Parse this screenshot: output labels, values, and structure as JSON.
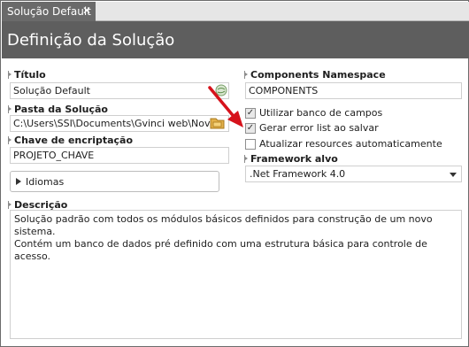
{
  "tab": {
    "title": "Solução Default",
    "close_glyph": "✕"
  },
  "header": {
    "title": "Definição da Solução"
  },
  "fields": {
    "titulo": {
      "label": "Título",
      "value": "Solução Default"
    },
    "pasta": {
      "label": "Pasta da Solução",
      "value": "C:\\Users\\SSI\\Documents\\Gvinci web\\Nov"
    },
    "chave": {
      "label": "Chave de encriptação",
      "value": "PROJETO_CHAVE"
    },
    "namespace": {
      "label": "Components Namespace",
      "value": "COMPONENTS"
    }
  },
  "checkboxes": [
    {
      "label": "Utilizar banco de campos",
      "checked": true
    },
    {
      "label": "Gerar error list ao salvar",
      "checked": true
    },
    {
      "label": "Atualizar resources automaticamente",
      "checked": false
    }
  ],
  "framework": {
    "label": "Framework alvo",
    "value": ".Net Framework 4.0"
  },
  "idiomas": {
    "label": "Idiomas"
  },
  "descricao": {
    "label": "Descrição",
    "line1": "Solução padrão com todos os módulos básicos definidos para construção de um novo sistema.",
    "line2": "Contém um banco de dados pré definido com uma estrutura básica para controle de acesso."
  },
  "colors": {
    "tab_bg": "#6a6a6a",
    "header_bg": "#5e5e5e",
    "annotation_arrow": "#d6121b"
  },
  "icons": {
    "titulo_field": "globe-icon",
    "pasta_field": "folder-browse-icon"
  }
}
